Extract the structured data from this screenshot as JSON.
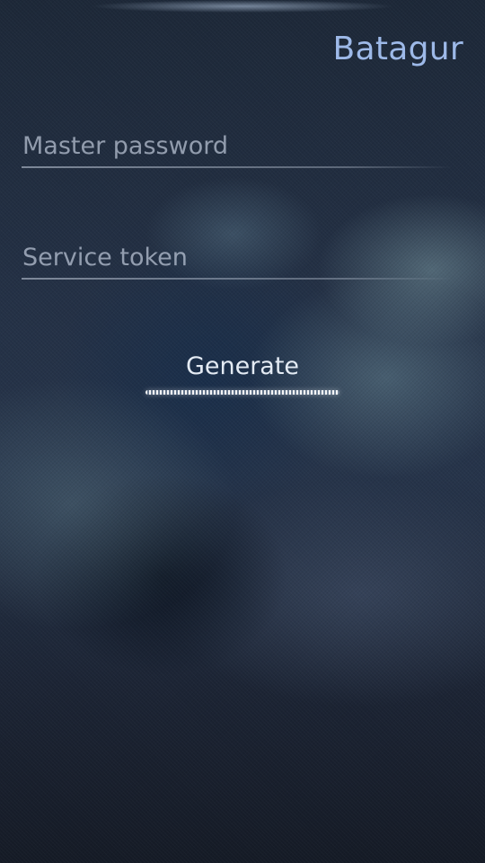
{
  "header": {
    "title": "Batagur"
  },
  "form": {
    "master_password": {
      "placeholder": "Master password",
      "value": ""
    },
    "service_token": {
      "placeholder": "Service token",
      "value": ""
    },
    "generate_label": "Generate"
  },
  "colors": {
    "title": "#9db9e8",
    "text": "#e4ebf4",
    "background": "#1d2838"
  }
}
